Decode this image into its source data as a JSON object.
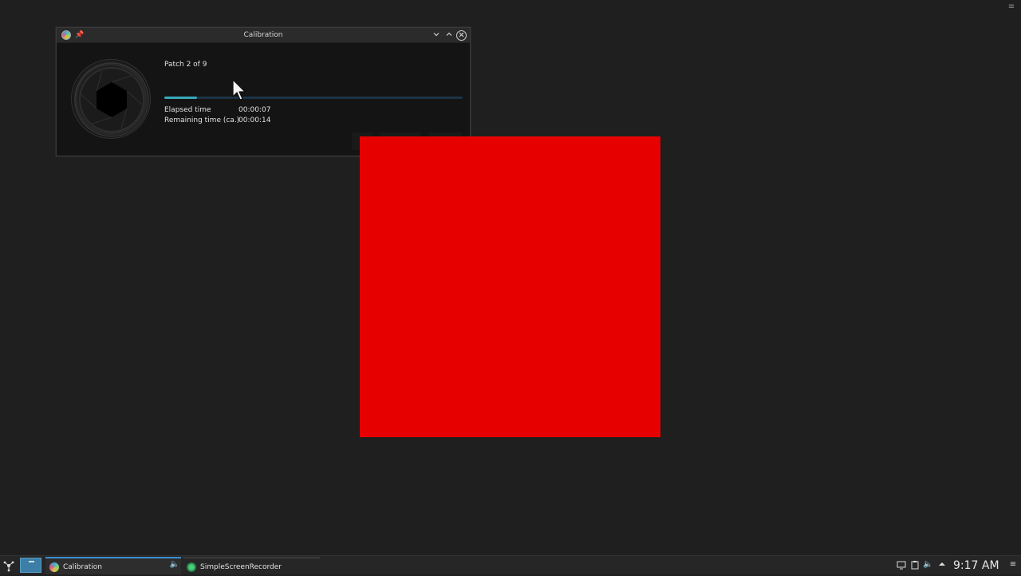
{
  "window": {
    "title": "Calibration",
    "patch_label": "Patch 2 of 9",
    "progress": 0.11,
    "elapsed_label": "Elapsed time",
    "elapsed_value": "00:00:07",
    "remaining_label": "Remaining time (ca.)",
    "remaining_value": "00:00:14"
  },
  "patch": {
    "color": "#e60000"
  },
  "colors": {
    "accent": "#36a8b8",
    "taskbar_active": "#3d8ed0"
  },
  "icons": {
    "window_app": "displaycal-icon",
    "pin": "pin-icon",
    "minimize": "chevron-down-icon",
    "maximize": "chevron-up-icon",
    "close": "close-icon",
    "launcher": "plasma-launcher-icon",
    "speaker": "speaker-icon",
    "clipboard": "clipboard-icon",
    "expand_tray": "chevron-up-icon"
  },
  "taskbar": {
    "tasks": [
      {
        "label": "Calibration",
        "active": true
      },
      {
        "label": "SimpleScreenRecorder",
        "active": false
      }
    ],
    "clock": "9:17 AM"
  }
}
